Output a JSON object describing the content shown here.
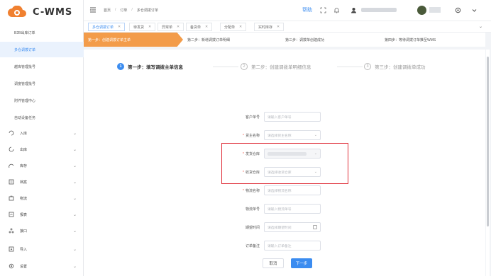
{
  "brand": {
    "logo_text": "C-WMS"
  },
  "sidebar": {
    "items": [
      {
        "label": "B2B出库订单"
      },
      {
        "label": "多仓调拨订单"
      },
      {
        "label": "越库管理批号"
      },
      {
        "label": "调度管理批号"
      },
      {
        "label": "附件管理中心"
      },
      {
        "label": "自动设备任务"
      }
    ],
    "groups": [
      {
        "label": "入库",
        "icon": "inbound-icon"
      },
      {
        "label": "出库",
        "icon": "outbound-icon"
      },
      {
        "label": "库存",
        "icon": "inventory-icon"
      },
      {
        "label": "档案",
        "icon": "archive-icon"
      },
      {
        "label": "物流",
        "icon": "logistics-icon"
      },
      {
        "label": "报表",
        "icon": "report-icon"
      },
      {
        "label": "接口",
        "icon": "interface-icon"
      },
      {
        "label": "导入",
        "icon": "import-icon"
      },
      {
        "label": "设置",
        "icon": "settings-icon"
      }
    ]
  },
  "topbar": {
    "breadcrumb": [
      "首页",
      "订单",
      "多仓调拨订单"
    ],
    "help_label": "帮助"
  },
  "tabs": [
    {
      "label": "多仓调拨订单",
      "active": true
    },
    {
      "label": "待发货",
      "active": false
    },
    {
      "label": "异常单",
      "active": false
    },
    {
      "label": "备货单",
      "active": false
    },
    {
      "label": "分配单",
      "active": false
    },
    {
      "label": "实时库存",
      "active": false
    }
  ],
  "step_strip": [
    {
      "label": "第一步：创建调拨订单主单"
    },
    {
      "label": "第二步：新增调拨订单明细"
    },
    {
      "label": "第三步：调拨单创建成功"
    },
    {
      "label": "第四步：等待调拨订单推至WMS"
    }
  ],
  "wizard": [
    {
      "num": "1",
      "label": "第一步：填写调拨主单信息",
      "active": true
    },
    {
      "num": "2",
      "label": "第二步：创建调拨单明细信息",
      "active": false
    },
    {
      "num": "3",
      "label": "第三步：创建调拨单成功",
      "active": false
    }
  ],
  "form": {
    "customer_no": {
      "label": "客户单号",
      "placeholder": "请输入客户单号"
    },
    "owner": {
      "label": "货主名称",
      "placeholder": "请选择货主名称"
    },
    "from_wh": {
      "label": "发货仓库"
    },
    "to_wh": {
      "label": "收货仓库",
      "placeholder": "请选择收货仓库"
    },
    "carrier": {
      "label": "物流名称",
      "placeholder": "请选择物流名称"
    },
    "tracking": {
      "label": "物流单号",
      "placeholder": "请输入物流单号"
    },
    "expected": {
      "label": "期望时间",
      "placeholder": "请选择期望时间"
    },
    "remark": {
      "label": "订单备注",
      "placeholder": "请输入订单备注"
    }
  },
  "buttons": {
    "cancel": "取消",
    "next": "下一步"
  },
  "colors": {
    "primary": "#3b8cf0",
    "step_orange": "#f39c4a",
    "highlight_red": "#e0303a"
  }
}
